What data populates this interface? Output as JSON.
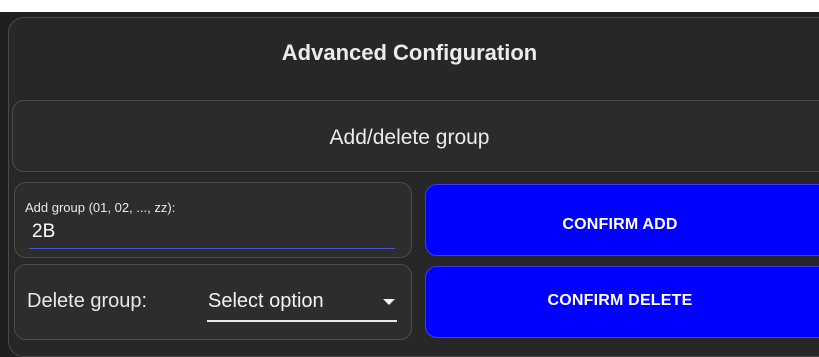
{
  "panel": {
    "title": "Advanced Configuration",
    "section_title": "Add/delete group"
  },
  "add_group": {
    "label": "Add group (01, 02, ..., zz):",
    "value": "2B",
    "button_label": "CONFIRM ADD"
  },
  "delete_group": {
    "label": "Delete group:",
    "select_value": "Select option",
    "button_label": "CONFIRM DELETE"
  },
  "colors": {
    "background": "#1f1f1f",
    "panel": "#272727",
    "button": "#0000ff",
    "input_underline": "#4c56c8"
  }
}
